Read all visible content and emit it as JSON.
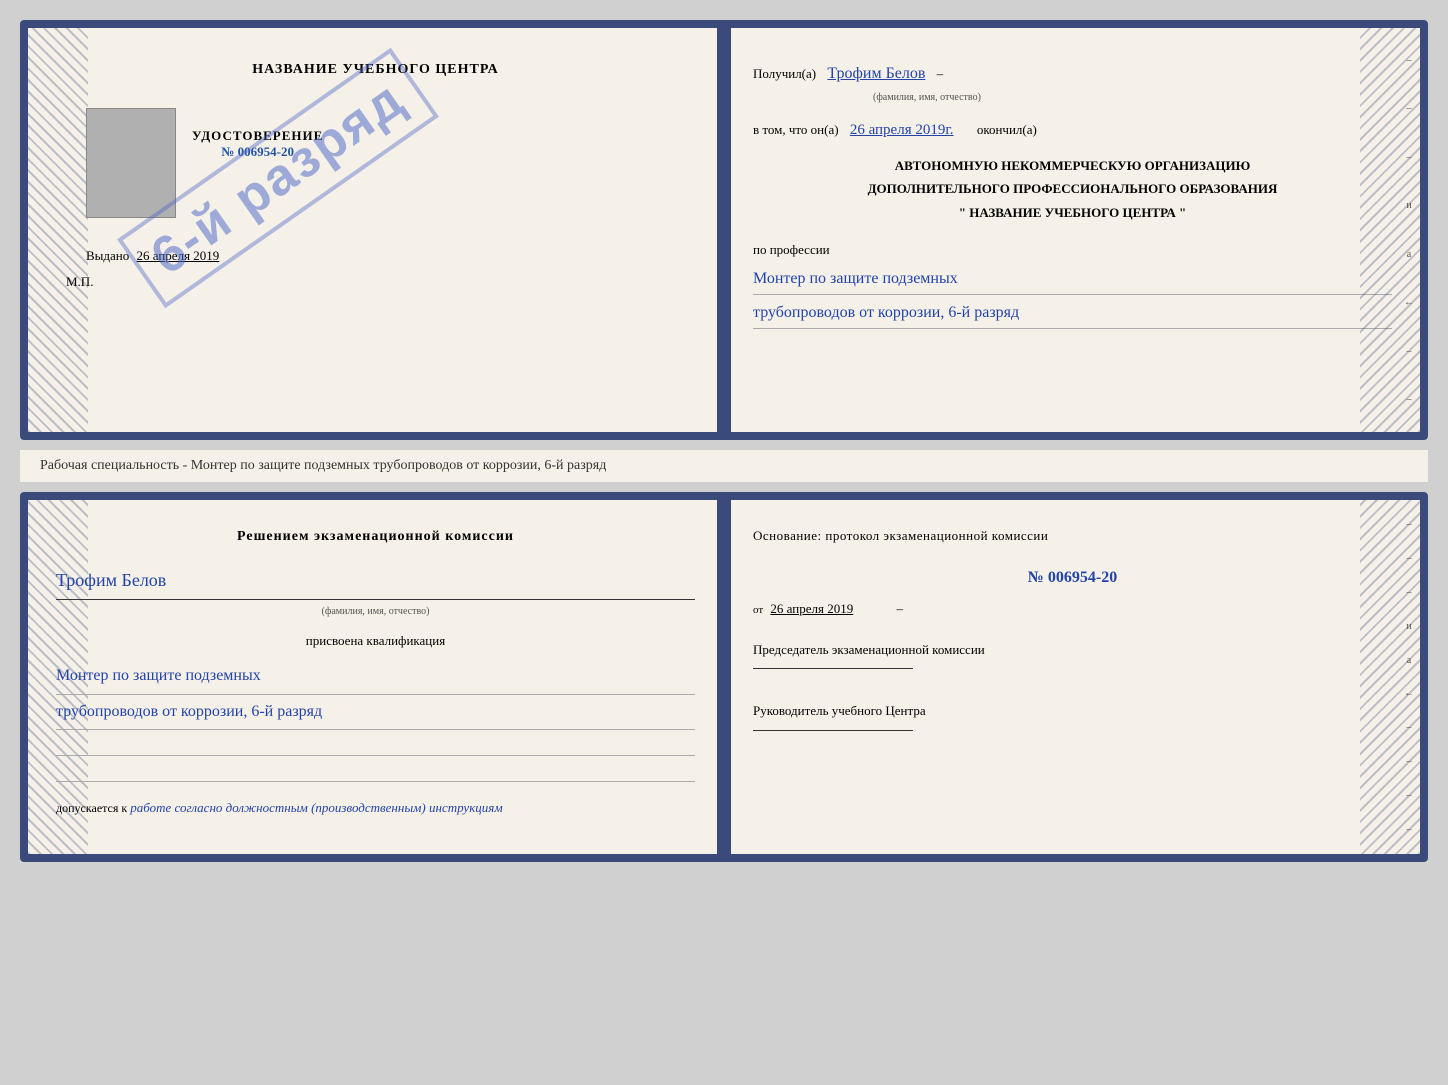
{
  "top_cert": {
    "left": {
      "title": "НАЗВАНИЕ УЧЕБНОГО ЦЕНТРА",
      "stamp_text": "6-й разряд",
      "udost_label": "УДОСТОВЕРЕНИЕ",
      "udost_num": "№ 006954-20",
      "vydano_label": "Выдано",
      "vydano_date": "26 апреля 2019",
      "mp_label": "М.П."
    },
    "right": {
      "poluchil_label": "Получил(а)",
      "poluchil_name": "Трофим Белов",
      "fio_sub": "(фамилия, имя, отчество)",
      "dash1": "–",
      "vtom_label": "в том, что он(а)",
      "date_value": "26 апреля 2019г.",
      "okonchil_label": "окончил(а)",
      "org_line1": "АВТОНОМНУЮ НЕКОММЕРЧЕСКУЮ ОРГАНИЗАЦИЮ",
      "org_line2": "ДОПОЛНИТЕЛЬНОГО ПРОФЕССИОНАЛЬНОГО ОБРАЗОВАНИЯ",
      "org_line3": "\"  НАЗВАНИЕ УЧЕБНОГО ЦЕНТРА  \"",
      "po_professii": "по профессии",
      "profession_line1": "Монтер по защите подземных",
      "profession_line2": "трубопроводов от коррозии, 6-й разряд"
    }
  },
  "middle_label": "Рабочая специальность - Монтер по защите подземных трубопроводов от коррозии, 6-й разряд",
  "bottom_cert": {
    "left": {
      "reshenie_header": "Решением экзаменационной комиссии",
      "name_handwritten": "Трофим Белов",
      "fio_sub": "(фамилия, имя, отчество)",
      "prisvoena_label": "присвоена квалификация",
      "qual_line1": "Монтер по защите подземных",
      "qual_line2": "трубопроводов от коррозии, 6-й разряд",
      "dopuskaetsya_label": "допускается к",
      "dopuskaetsya_value": "работе согласно должностным (производственным) инструкциям"
    },
    "right": {
      "osnovanie_label": "Основание: протокол экзаменационной комиссии",
      "protocol_num": "№ 006954-20",
      "ot_label": "от",
      "ot_date": "26 апреля 2019",
      "predsedatel_label": "Председатель экзаменационной комиссии",
      "rukovoditel_label": "Руководитель учебного Центра"
    }
  },
  "side_marks": {
    "items": [
      "–",
      "–",
      "–",
      "и",
      "а",
      "←",
      "–",
      "–",
      "–",
      "–"
    ]
  }
}
